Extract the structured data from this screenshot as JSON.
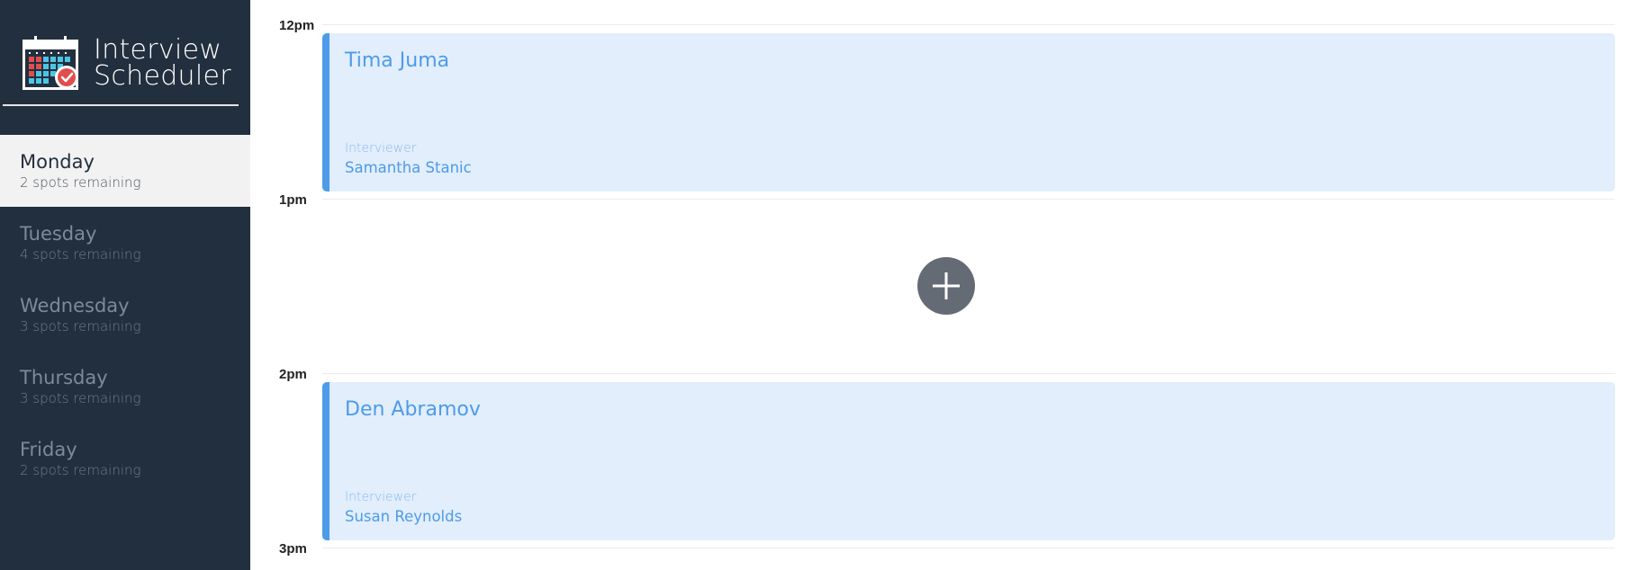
{
  "brand": {
    "title_line1": "Interview",
    "title_line2": "Scheduler",
    "logo_icon": "calendar-check-icon"
  },
  "colors": {
    "sidebar_bg": "#222f3e",
    "selected_day_bg": "#f2f2f2",
    "appointment_bg": "#e2eefc",
    "appointment_accent": "#4d9be9",
    "add_button_bg": "#656b75"
  },
  "days": [
    {
      "name": "Monday",
      "spots": "2 spots remaining",
      "selected": true
    },
    {
      "name": "Tuesday",
      "spots": "4 spots remaining",
      "selected": false
    },
    {
      "name": "Wednesday",
      "spots": "3 spots remaining",
      "selected": false
    },
    {
      "name": "Thursday",
      "spots": "3 spots remaining",
      "selected": false
    },
    {
      "name": "Friday",
      "spots": "2 spots remaining",
      "selected": false
    }
  ],
  "schedule": {
    "hours": [
      "12pm",
      "1pm",
      "2pm",
      "3pm"
    ],
    "appointments": [
      {
        "time": "12pm",
        "student": "Tima Juma",
        "interviewer_label": "Interviewer",
        "interviewer": "Samantha Stanic"
      },
      {
        "time": "2pm",
        "student": "Den Abramov",
        "interviewer_label": "Interviewer",
        "interviewer": "Susan Reynolds"
      }
    ],
    "empty_slot": {
      "time": "1pm",
      "action_icon": "plus-icon"
    }
  }
}
